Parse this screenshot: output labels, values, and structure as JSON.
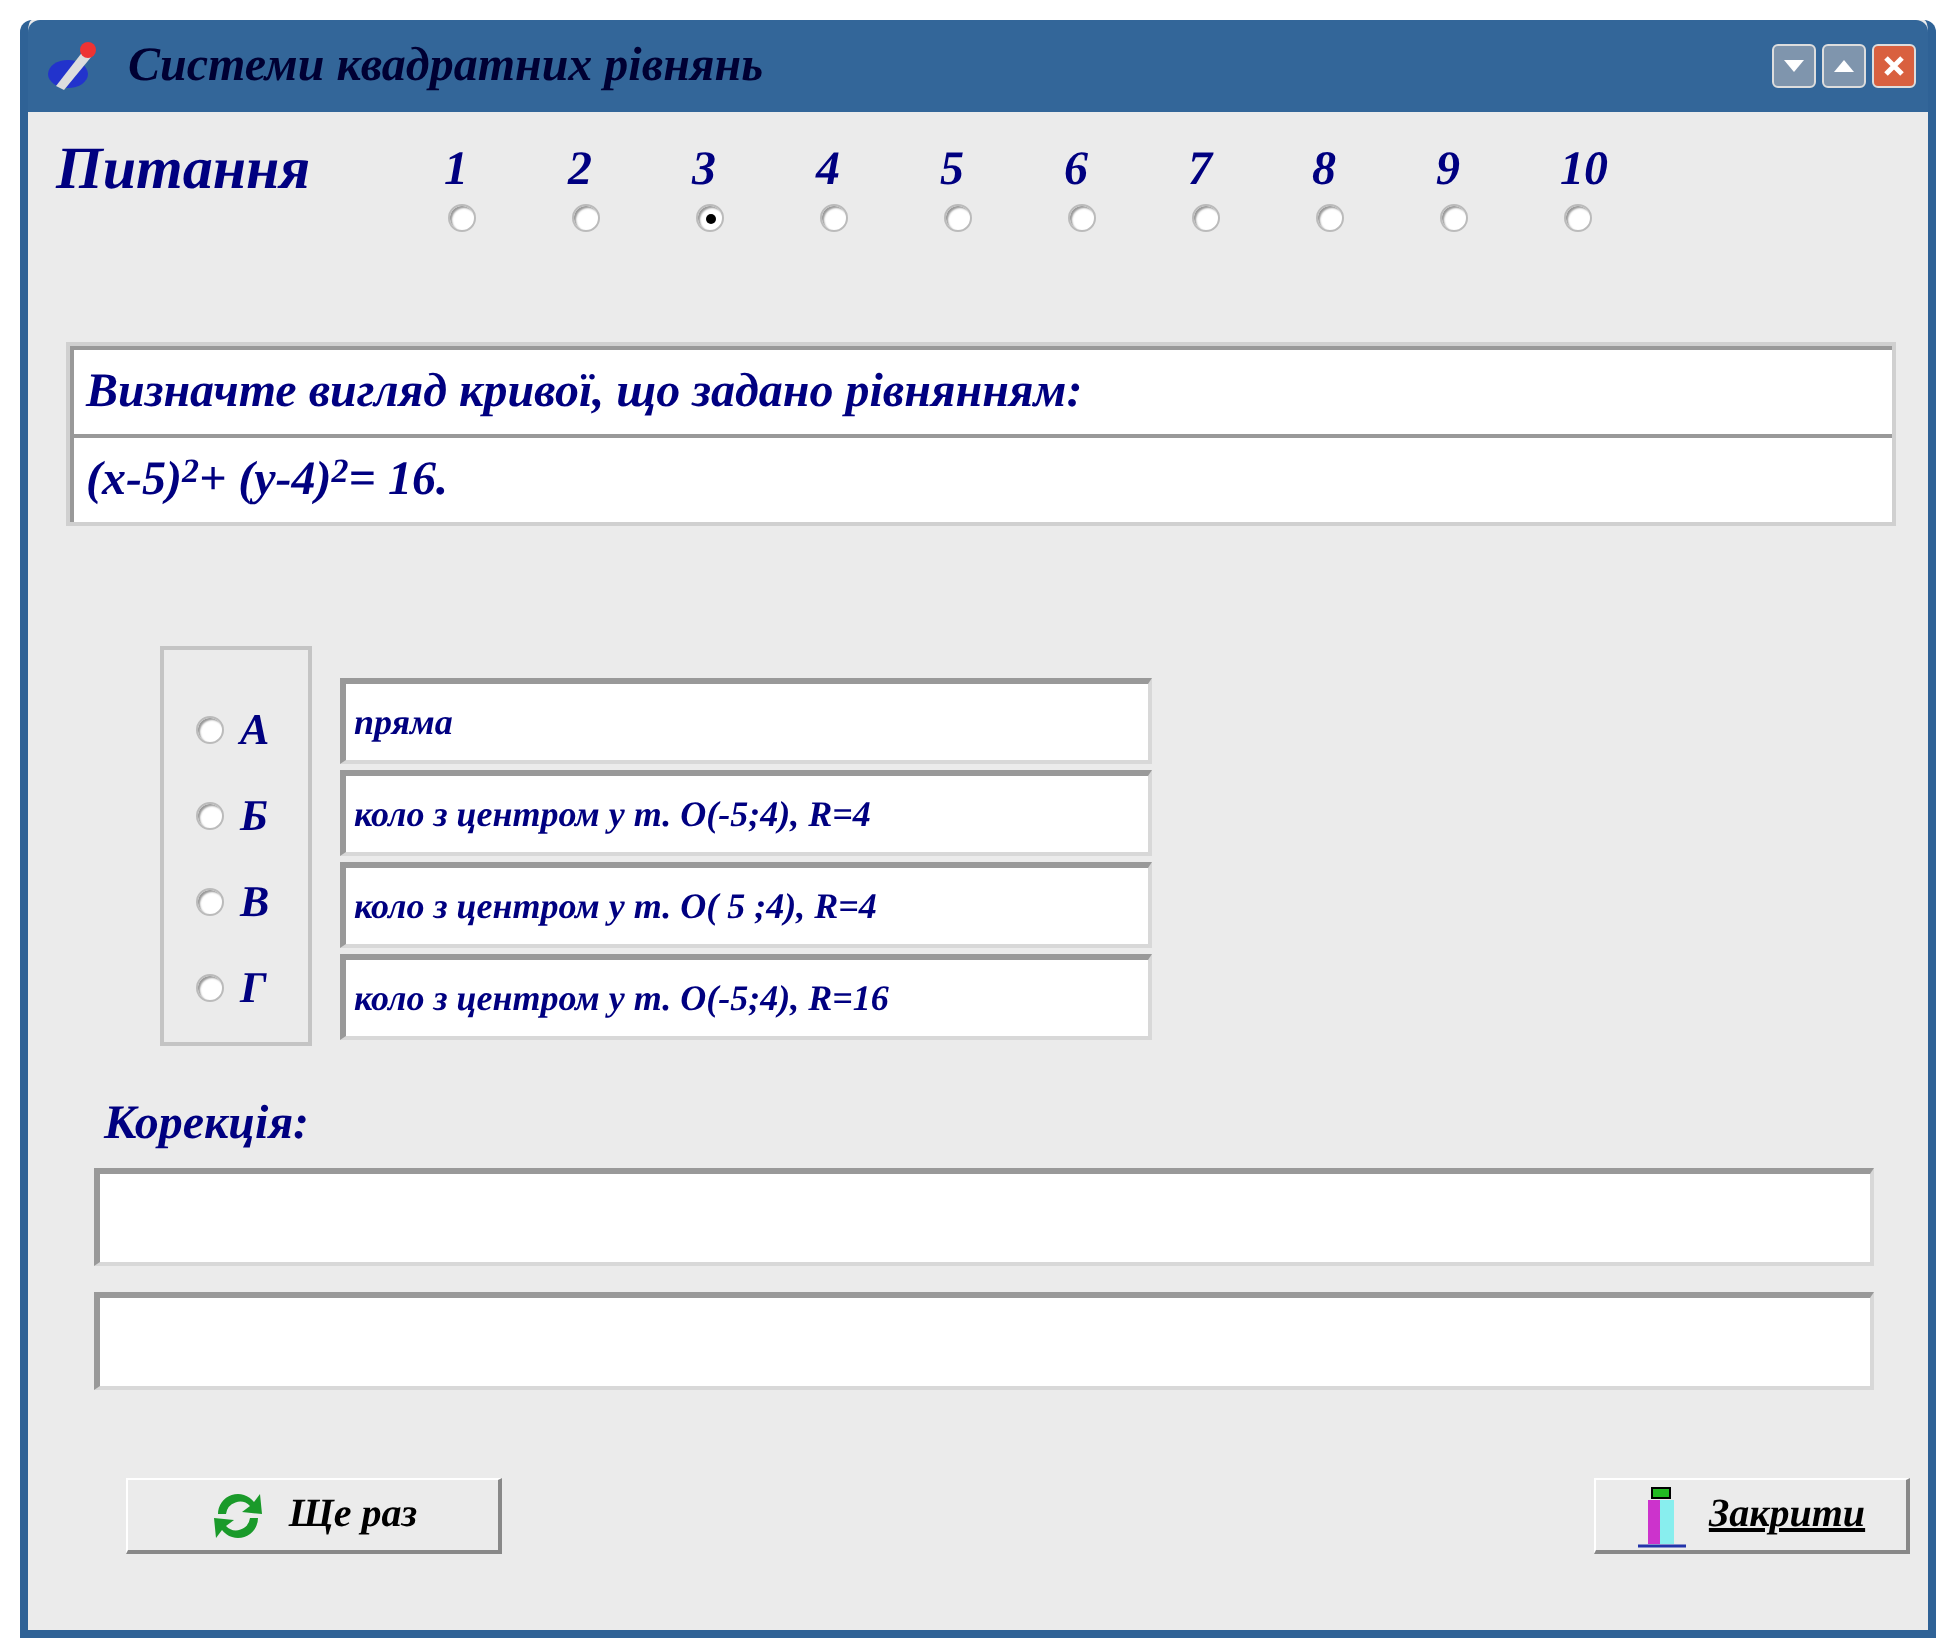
{
  "window": {
    "title": "Системи квадратних рівнянь"
  },
  "questions": {
    "label": "Питання",
    "items": [
      {
        "number": "1",
        "selected": false
      },
      {
        "number": "2",
        "selected": false
      },
      {
        "number": "3",
        "selected": true
      },
      {
        "number": "4",
        "selected": false
      },
      {
        "number": "5",
        "selected": false
      },
      {
        "number": "6",
        "selected": false
      },
      {
        "number": "7",
        "selected": false
      },
      {
        "number": "8",
        "selected": false
      },
      {
        "number": "9",
        "selected": false
      },
      {
        "number": "10",
        "selected": false
      }
    ]
  },
  "question_text": [
    "Визначте вигляд кривої, що задано рівнянням:",
    "(x-5)$^{2}$+ (y-4)$^{2}$= 16."
  ],
  "answers": [
    {
      "letter": "А",
      "text": "пряма",
      "selected": false
    },
    {
      "letter": "Б",
      "text": "коло з центром у т. O(-5;4), R=4",
      "selected": false
    },
    {
      "letter": "В",
      "text": "коло з центром у т. O( 5 ;4), R=4",
      "selected": false
    },
    {
      "letter": "Г",
      "text": "коло з центром у т. O(-5;4), R=16",
      "selected": false
    }
  ],
  "correction": {
    "label": "Корекція:"
  },
  "buttons": {
    "retry": "Ще раз",
    "close": "Закрити"
  }
}
